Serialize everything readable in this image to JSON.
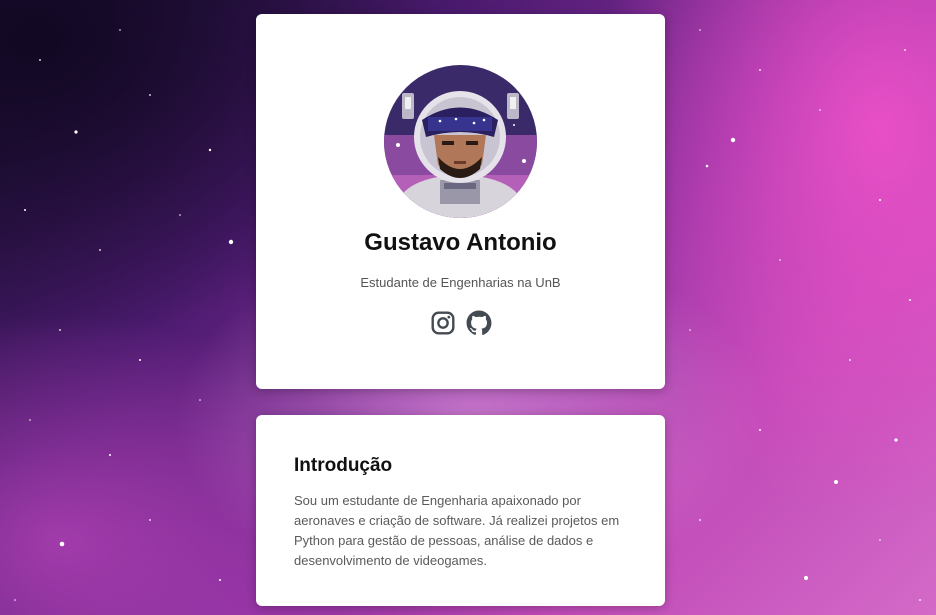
{
  "profile": {
    "name": "Gustavo Antonio",
    "subtitle": "Estudante de Engenharias na UnB",
    "avatar_icon": "astronaut-avatar",
    "socials": [
      {
        "icon": "instagram-icon"
      },
      {
        "icon": "github-icon"
      }
    ]
  },
  "intro": {
    "title": "Introdução",
    "text": "Sou um estudante de Engenharia apaixonado por aeronaves e criação de software. Já realizei projetos em Python para gestão de pessoas, análise de dados e desenvolvimento de videogames."
  },
  "colors": {
    "card_background": "#ffffff",
    "heading": "#111111",
    "body_text": "#5a5a5a",
    "icon": "#444a52"
  }
}
